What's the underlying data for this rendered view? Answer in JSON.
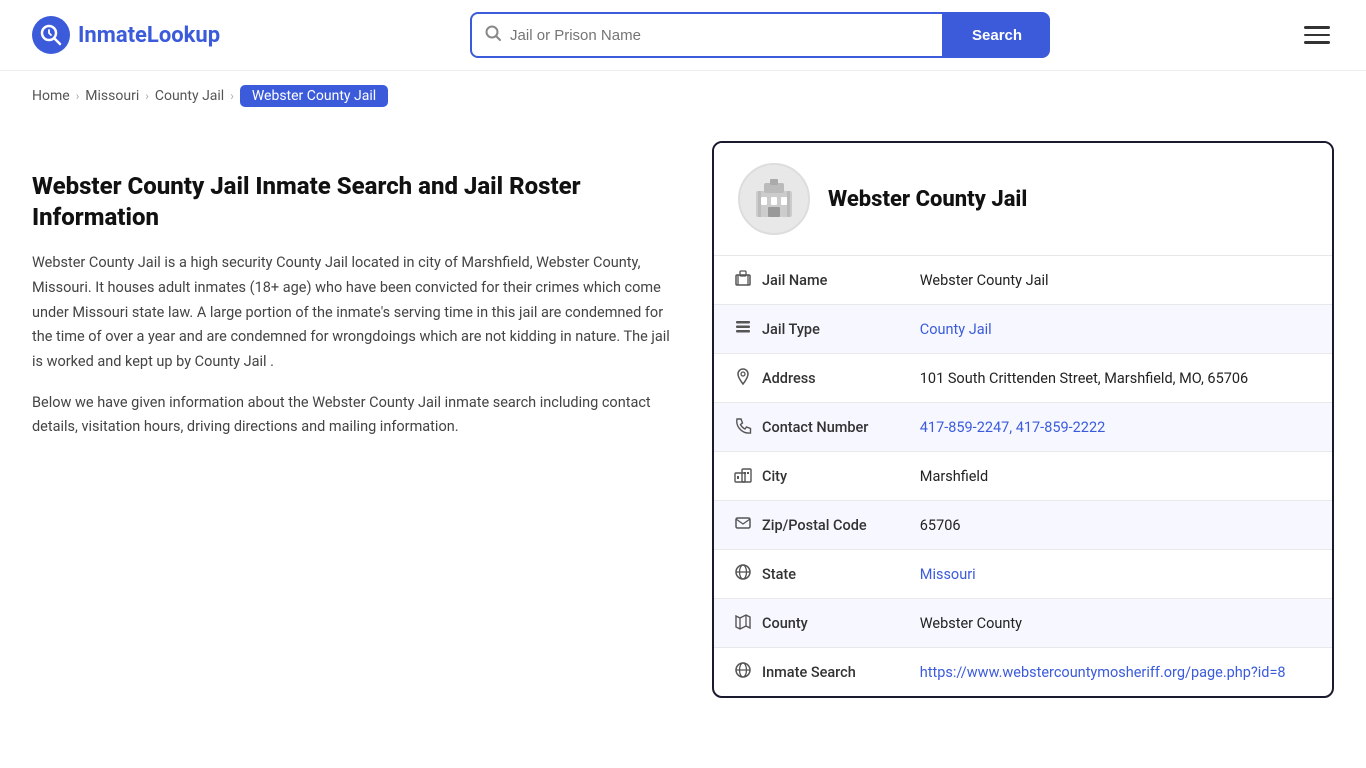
{
  "header": {
    "logo_text": "InmateLookup",
    "search_placeholder": "Jail or Prison Name",
    "search_button_label": "Search"
  },
  "breadcrumb": {
    "items": [
      {
        "label": "Home",
        "href": "#",
        "current": false
      },
      {
        "label": "Missouri",
        "href": "#",
        "current": false
      },
      {
        "label": "County Jail",
        "href": "#",
        "current": false
      },
      {
        "label": "Webster County Jail",
        "href": "#",
        "current": true
      }
    ]
  },
  "left": {
    "title": "Webster County Jail Inmate Search and Jail Roster Information",
    "desc1": "Webster County Jail is a high security County Jail located in city of Marshfield, Webster County, Missouri. It houses adult inmates (18+ age) who have been convicted for their crimes which come under Missouri state law. A large portion of the inmate's serving time in this jail are condemned for the time of over a year and are condemned for wrongdoings which are not kidding in nature. The jail is worked and kept up by County Jail .",
    "desc2": "Below we have given information about the Webster County Jail inmate search including contact details, visitation hours, driving directions and mailing information."
  },
  "card": {
    "title": "Webster County Jail",
    "rows": [
      {
        "label": "Jail Name",
        "value": "Webster County Jail",
        "link": false,
        "icon": "jail"
      },
      {
        "label": "Jail Type",
        "value": "County Jail",
        "link": true,
        "href": "#",
        "icon": "list"
      },
      {
        "label": "Address",
        "value": "101 South Crittenden Street, Marshfield, MO, 65706",
        "link": false,
        "icon": "pin"
      },
      {
        "label": "Contact Number",
        "value": "417-859-2247, 417-859-2222",
        "link": true,
        "href": "tel:4178592247",
        "icon": "phone"
      },
      {
        "label": "City",
        "value": "Marshfield",
        "link": false,
        "icon": "city"
      },
      {
        "label": "Zip/Postal Code",
        "value": "65706",
        "link": false,
        "icon": "mail"
      },
      {
        "label": "State",
        "value": "Missouri",
        "link": true,
        "href": "#",
        "icon": "globe"
      },
      {
        "label": "County",
        "value": "Webster County",
        "link": false,
        "icon": "map"
      },
      {
        "label": "Inmate Search",
        "value": "https://www.webstercountymosheriff.org/page.php?id=8",
        "link": true,
        "href": "https://www.webstercountymosheriff.org/page.php?id=8",
        "icon": "globe2"
      }
    ]
  }
}
